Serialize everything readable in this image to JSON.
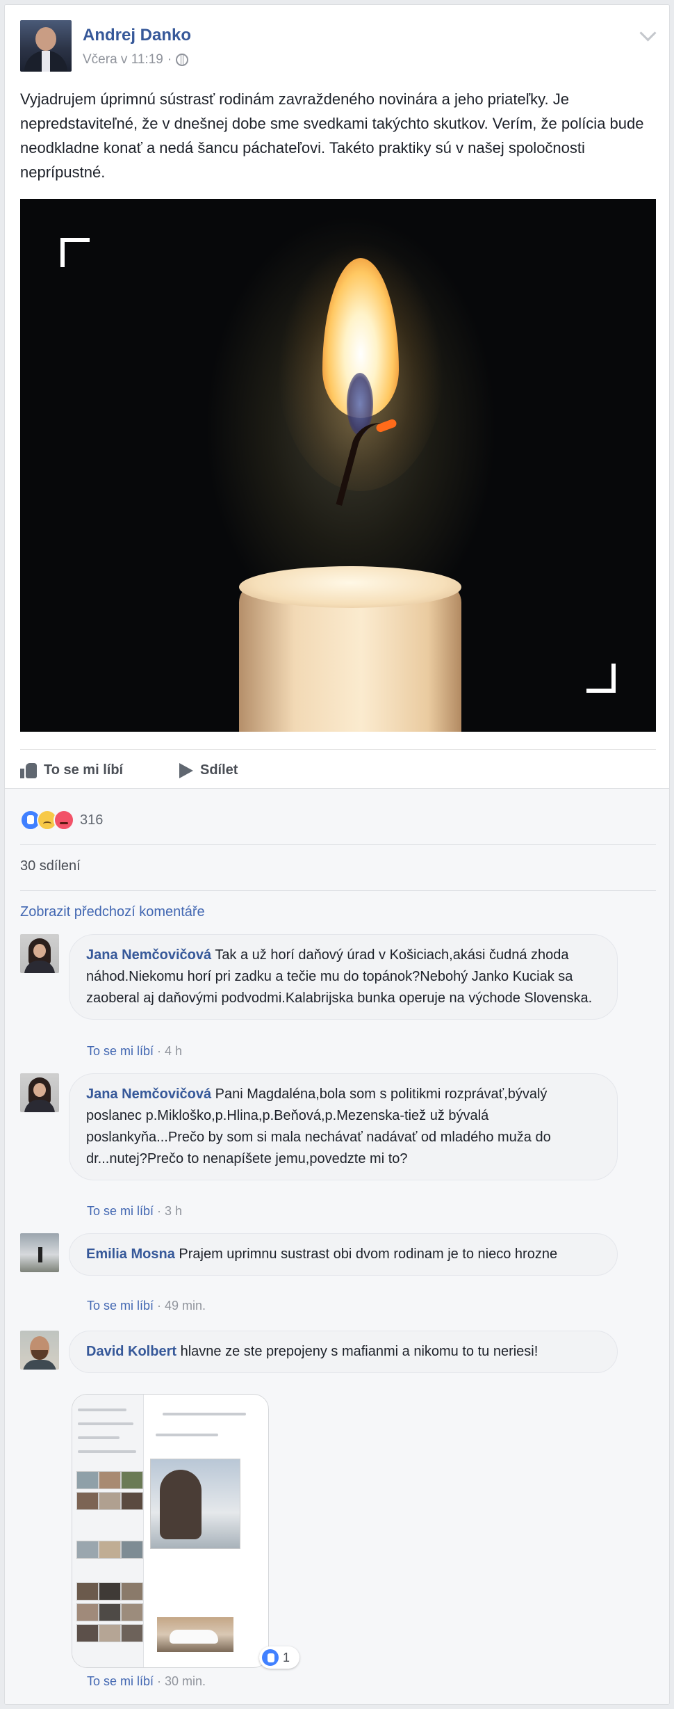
{
  "post": {
    "author": "Andrej Danko",
    "timestamp": "Včera v 11:19",
    "separator": "·",
    "text": "Vyjadrujem úprimnú sústrasť rodinám zavraždeného novinára a jeho priateľky. Je nepredstaviteľné, že v dnešnej dobe sme svedkami takýchto skutkov. Verím, že polícia bude neodkladne konať a nedá šancu páchateľovi. Takéto praktiky sú v našej spoločnosti neprípustné."
  },
  "actions": {
    "like_label": "To se mi líbí",
    "share_label": "Sdílet"
  },
  "feedback": {
    "reaction_count": "316",
    "reactions": [
      "like",
      "sad",
      "angry"
    ],
    "shares": "30 sdílení",
    "previous_comments": "Zobrazit předchozí komentáře"
  },
  "comments": [
    {
      "name": "Jana Nemčovičová",
      "text": "Tak a už horí daňový úrad v Košiciach,akási čudná zhoda náhod.Niekomu horí pri zadku a tečie mu do topánok?Nebohý Janko Kuciak sa zaoberal aj daňovými podvodmi.Kalabrijska bunka operuje na východe Slovenska.",
      "like": "To se mi líbí",
      "age": "4 h"
    },
    {
      "name": "Jana Nemčovičová",
      "text": "Pani Magdaléna,bola som s politikmi rozprávať,bývalý poslanec p.Mikloško,p.Hlina,p.Beňová,p.Mezenska-tiež už bývalá poslankyňa...Prečo by som si mala nechávať nadávať od mladého muža do dr...nutej?Prečo to nenapíšete jemu,povedzte mi to?",
      "like": "To se mi líbí",
      "age": "3 h"
    },
    {
      "name": "Emilia Mosna",
      "text": "Prajem uprimnu sustrast obi dvom rodinam je to nieco hrozne",
      "like": "To se mi líbí",
      "age": "49 min."
    },
    {
      "name": "David Kolbert",
      "text": "hlavne ze ste prepojeny s mafianmi a nikomu to tu neriesi!",
      "like": "To se mi líbí",
      "age": "30 min.",
      "attachment_reactions": "1"
    }
  ],
  "colors": {
    "link_blue": "#365899",
    "accent_blue": "#4267b2",
    "like_reaction": "#4080ff",
    "sad_reaction": "#f7c948",
    "angry_reaction": "#f25268",
    "feedback_bg": "#f6f7f9"
  },
  "icons": [
    "chevron-down-icon",
    "globe-icon",
    "thumbs-up-icon",
    "share-arrow-icon"
  ]
}
